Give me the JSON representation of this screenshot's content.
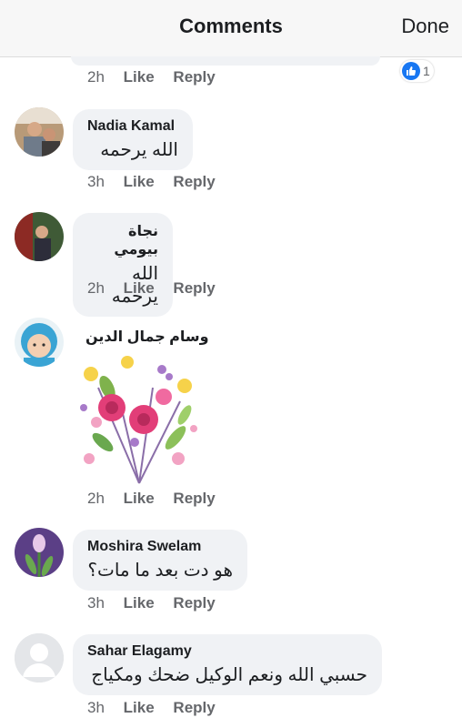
{
  "header": {
    "title": "Comments",
    "done_label": "Done"
  },
  "first_comment": {
    "time": "2h",
    "like": "Like",
    "reply": "Reply",
    "reaction_count": "1"
  },
  "comments": [
    {
      "name": "Nadia Kamal",
      "text": "الله يرحمه",
      "time": "3h",
      "like": "Like",
      "reply": "Reply"
    },
    {
      "name": "نجاة بيومي",
      "text": "الله يرحمه",
      "time": "2h",
      "like": "Like",
      "reply": "Reply"
    },
    {
      "name": "وسام جمال الدين",
      "text": "",
      "time": "2h",
      "like": "Like",
      "reply": "Reply"
    },
    {
      "name": "Moshira Swelam",
      "text": "هو دت بعد ما مات؟",
      "time": "3h",
      "like": "Like",
      "reply": "Reply"
    },
    {
      "name": "Sahar Elagamy",
      "text": "حسبي الله ونعم الوكيل ضحك ومكياج",
      "time": "3h",
      "like": "Like",
      "reply": "Reply"
    }
  ],
  "colors": {
    "accent": "#1877f2",
    "bubble": "#f0f2f5",
    "meta": "#65676b"
  }
}
